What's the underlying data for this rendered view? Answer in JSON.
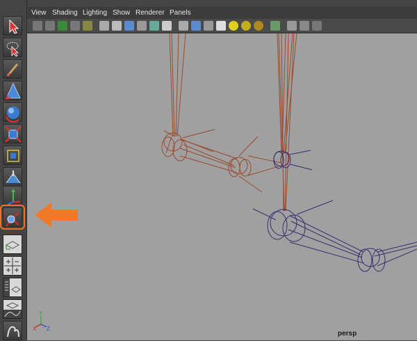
{
  "menubar": {
    "view": "View",
    "shading": "Shading",
    "lighting": "Lighting",
    "show": "Show",
    "renderer": "Renderer",
    "panels": "Panels"
  },
  "toolbox": {
    "tools": [
      "select-tool",
      "lasso-tool",
      "paint-select-tool",
      "move-tool",
      "rotate-tool",
      "scale-tool",
      "universal-manipulator",
      "soft-modification",
      "show-manipulator",
      "joint-tool"
    ],
    "highlighted_tool": "joint-tool"
  },
  "viewport": {
    "camera_name": "persp",
    "axis_labels": {
      "x": "X",
      "y": "Y",
      "z": "Z"
    }
  },
  "colors": {
    "highlight": "#e8742a",
    "joint_selected": "#9a4a2e",
    "joint_default": "#3a2a70",
    "viewport_bg": "#a0a0a0"
  }
}
